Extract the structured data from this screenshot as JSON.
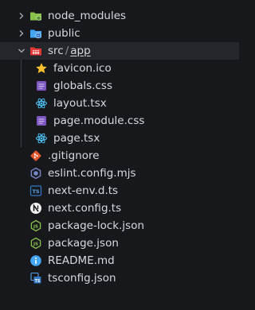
{
  "explorer": {
    "folders": {
      "node_modules": {
        "label": "node_modules",
        "icon": "folder-node-icon",
        "expanded": false
      },
      "public": {
        "label": "public",
        "icon": "folder-public-icon",
        "expanded": false
      },
      "src_app": {
        "label_src": "src",
        "label_sep": "/",
        "label_app": "app",
        "icon": "folder-app-icon",
        "expanded": true
      }
    },
    "app_files": [
      {
        "label": "favicon.ico",
        "icon": "star-icon"
      },
      {
        "label": "globals.css",
        "icon": "css-file-icon"
      },
      {
        "label": "layout.tsx",
        "icon": "react-icon"
      },
      {
        "label": "page.module.css",
        "icon": "css-file-icon"
      },
      {
        "label": "page.tsx",
        "icon": "react-icon"
      }
    ],
    "root_files": [
      {
        "label": ".gitignore",
        "icon": "git-icon"
      },
      {
        "label": "eslint.config.mjs",
        "icon": "eslint-icon"
      },
      {
        "label": "next-env.d.ts",
        "icon": "typescript-icon"
      },
      {
        "label": "next.config.ts",
        "icon": "nextjs-icon"
      },
      {
        "label": "package-lock.json",
        "icon": "nodejs-icon"
      },
      {
        "label": "package.json",
        "icon": "nodejs-icon"
      },
      {
        "label": "README.md",
        "icon": "info-icon"
      },
      {
        "label": "tsconfig.json",
        "icon": "tsconfig-icon"
      }
    ],
    "colors": {
      "background": "#17181c",
      "text": "#d7d9de",
      "selected_row": "#24262c",
      "folder_green": "#8bc34a",
      "folder_blue": "#42a5f5",
      "folder_red": "#e53935",
      "star_yellow": "#fbc02d",
      "css_purple": "#7e57c2",
      "react_blue": "#4fc3f7",
      "git_orange": "#e4572e",
      "eslint_purple": "#5c6bc0",
      "ts_blue": "#3178c6",
      "node_green": "#8bc34a",
      "info_blue": "#42a5f5"
    }
  }
}
